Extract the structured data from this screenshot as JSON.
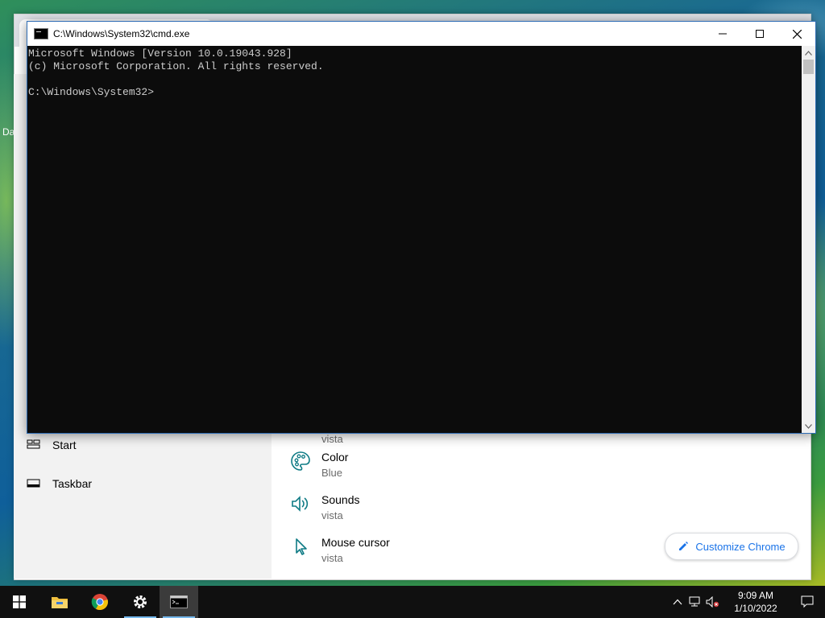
{
  "cmd": {
    "title": "C:\\Windows\\System32\\cmd.exe",
    "lines": [
      "Microsoft Windows [Version 10.0.19043.928]",
      "(c) Microsoft Corporation. All rights reserved.",
      "",
      "C:\\Windows\\System32>"
    ]
  },
  "desktop": {
    "edge_text": "Da"
  },
  "settings": {
    "nav": [
      {
        "label": "Start",
        "icon": "start-layout-icon"
      },
      {
        "label": "Taskbar",
        "icon": "taskbar-icon"
      }
    ],
    "partial_sub": "vista",
    "items": [
      {
        "title": "Color",
        "sub": "Blue",
        "icon": "palette-icon"
      },
      {
        "title": "Sounds",
        "sub": "vista",
        "icon": "speaker-icon"
      },
      {
        "title": "Mouse cursor",
        "sub": "vista",
        "icon": "cursor-icon"
      }
    ],
    "accent": "#0f7b85"
  },
  "chrome": {
    "customize_label": "Customize Chrome"
  },
  "taskbar": {
    "apps": [
      "start-icon",
      "file-explorer-icon",
      "chrome-icon",
      "settings-icon",
      "cmd-icon"
    ],
    "time": "9:09 AM",
    "date": "1/10/2022"
  }
}
